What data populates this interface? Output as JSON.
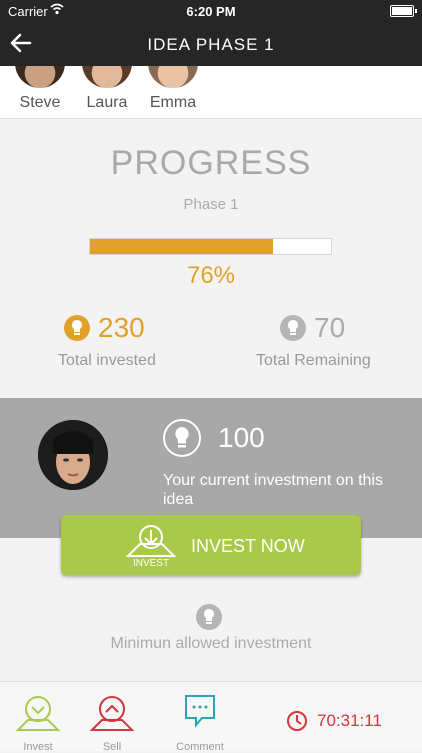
{
  "status": {
    "carrier": "Carrier",
    "time": "6:20 PM"
  },
  "nav": {
    "title": "IDEA PHASE 1"
  },
  "members": [
    {
      "name": "Steve"
    },
    {
      "name": "Laura"
    },
    {
      "name": "Emma"
    }
  ],
  "progress": {
    "title": "PROGRESS",
    "phase": "Phase 1",
    "percent_value": 76,
    "percent_label": "76%",
    "invested_value": "230",
    "invested_label": "Total invested",
    "remaining_value": "70",
    "remaining_label": "Total Remaining"
  },
  "investment": {
    "amount": "100",
    "description": "Your current investment on this idea",
    "button_icon_label": "INVEST",
    "button_label": "INVEST NOW",
    "minimum_label": "Minimun allowed investment"
  },
  "tabs": [
    {
      "label": "Invest",
      "icon": "invest-icon"
    },
    {
      "label": "Sell",
      "icon": "sell-icon"
    },
    {
      "label": "Comment",
      "icon": "comment-icon"
    }
  ],
  "timer": {
    "value": "70:31:11"
  },
  "colors": {
    "accent": "#e1a12b",
    "green": "#a9c94a",
    "red": "#d0363b",
    "teal": "#2aa5b5",
    "navbar": "#262626"
  }
}
